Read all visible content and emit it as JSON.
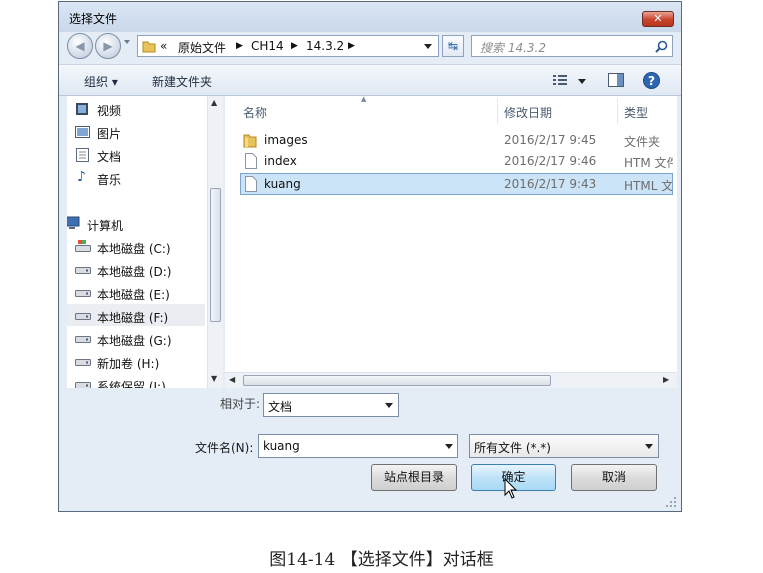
{
  "dialog": {
    "title": "选择文件",
    "close_icon": "close-icon"
  },
  "address": {
    "prefix": "«",
    "crumbs": [
      "原始文件",
      "CH14",
      "14.3.2"
    ],
    "search_placeholder": "搜索 14.3.2"
  },
  "toolbar": {
    "organize_label": "组织 ▾",
    "new_folder_label": "新建文件夹"
  },
  "sidebar": {
    "items": [
      {
        "label": "视频",
        "icon": "video-icon"
      },
      {
        "label": "图片",
        "icon": "picture-icon"
      },
      {
        "label": "文档",
        "icon": "document-icon"
      },
      {
        "label": "音乐",
        "icon": "music-icon"
      },
      {
        "label": "计算机",
        "icon": "computer-icon"
      },
      {
        "label": "本地磁盘 (C:)",
        "icon": "system-drive-icon"
      },
      {
        "label": "本地磁盘 (D:)",
        "icon": "drive-icon"
      },
      {
        "label": "本地磁盘 (E:)",
        "icon": "drive-icon"
      },
      {
        "label": "本地磁盘 (F:)",
        "icon": "drive-icon"
      },
      {
        "label": "本地磁盘 (G:)",
        "icon": "drive-icon"
      },
      {
        "label": "新加卷 (H:)",
        "icon": "drive-icon"
      },
      {
        "label": "系统保留 (I:)",
        "icon": "drive-icon"
      }
    ]
  },
  "files": {
    "columns": [
      "名称",
      "修改日期",
      "类型"
    ],
    "rows": [
      {
        "name": "images",
        "date": "2016/2/17 9:45",
        "type": "文件夹",
        "icon": "folder-icon"
      },
      {
        "name": "index",
        "date": "2016/2/17 9:46",
        "type": "HTM 文件",
        "icon": "file-icon"
      },
      {
        "name": "kuang",
        "date": "2016/2/17 9:43",
        "type": "HTML 文件",
        "icon": "file-icon"
      }
    ]
  },
  "form": {
    "relative_label": "相对于:",
    "relative_value": "文档",
    "filename_label": "文件名(N):",
    "filename_value": "kuang",
    "filetype_value": "所有文件 (*.*)"
  },
  "buttons": {
    "site_root": "站点根目录",
    "ok": "确定",
    "cancel": "取消"
  },
  "caption": "图14-14 【选择文件】对话框",
  "colors": {
    "selection": "#cce4f7",
    "selection_border": "#7da2ce",
    "window_bg": "#e4ecf5"
  }
}
